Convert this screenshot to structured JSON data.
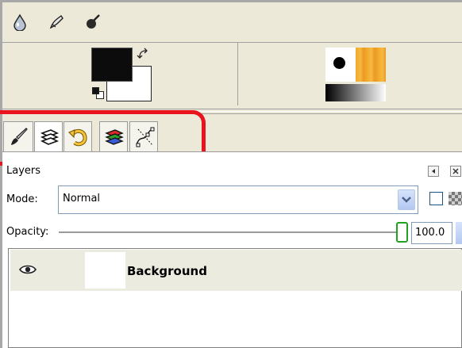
{
  "toolbox": {
    "tools": [
      {
        "icon": "blur-sharpen-icon"
      },
      {
        "icon": "smudge-icon"
      },
      {
        "icon": "dodge-burn-icon"
      }
    ]
  },
  "colors": {
    "foreground": "#0c0c0c",
    "background": "#ffffff",
    "highlight": "#e8131d",
    "pattern_accent": "#f3a82a"
  },
  "dock_tabs": [
    {
      "icon": "paintbrush-icon"
    },
    {
      "icon": "layers-icon"
    },
    {
      "icon": "undo-history-icon"
    },
    {
      "icon": "channels-icon"
    },
    {
      "icon": "paths-icon"
    }
  ],
  "layers_panel": {
    "title": "Layers",
    "mode_label": "Mode:",
    "mode_value": "Normal",
    "opacity_label": "Opacity:",
    "opacity_value": "100.0",
    "opacity_fraction": 1.0,
    "layers": [
      {
        "name": "Background",
        "visible": true
      }
    ]
  }
}
